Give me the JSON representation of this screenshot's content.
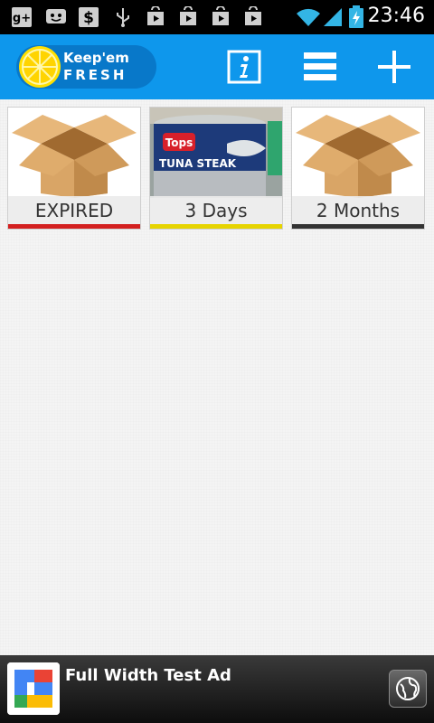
{
  "status_bar": {
    "time": "23:46",
    "icons": [
      "google-plus-icon",
      "messenger-icon",
      "dollar-icon",
      "usb-icon",
      "play-store-icon",
      "play-store-icon",
      "play-store-icon",
      "play-store-icon",
      "wifi-icon",
      "signal-icon",
      "battery-charging-icon"
    ]
  },
  "action_bar": {
    "logo_line1": "Keep'em",
    "logo_line2": "FRESH",
    "buttons": [
      "info-icon",
      "list-icon",
      "add-icon"
    ],
    "color": "#0e97ec"
  },
  "items": [
    {
      "label": "EXPIRED",
      "image": "cardboard-box",
      "status_color": "#d32020"
    },
    {
      "label": "3 Days",
      "image": "tuna-can-photo",
      "status_color": "#e6d400"
    },
    {
      "label": "2 Months",
      "image": "cardboard-box",
      "status_color": "#333333"
    }
  ],
  "ad": {
    "text": "Full Width Test Ad",
    "icon": "google-icon",
    "action_icon": "globe-icon"
  }
}
